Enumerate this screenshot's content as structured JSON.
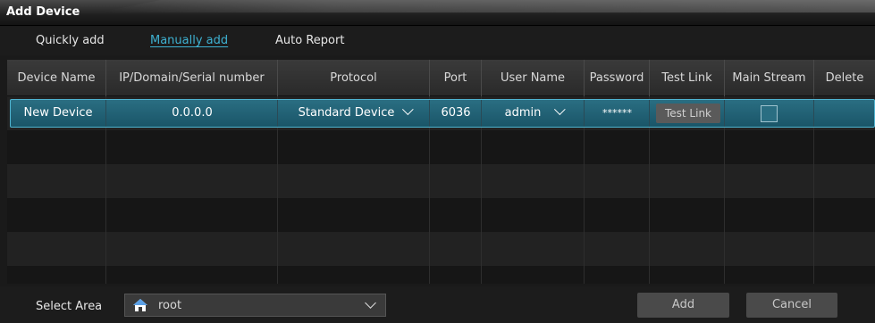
{
  "window": {
    "title": "Add Device"
  },
  "tabs": [
    {
      "label": "Quickly add"
    },
    {
      "label": "Manually add"
    },
    {
      "label": "Auto Report"
    }
  ],
  "columns": [
    "Device Name",
    "IP/Domain/Serial number",
    "Protocol",
    "Port",
    "User Name",
    "Password",
    "Test Link",
    "Main Stream",
    "Delete"
  ],
  "rows": [
    {
      "device_name": "New Device",
      "ip": "0.0.0.0",
      "protocol": "Standard Device",
      "port": "6036",
      "user_name": "admin",
      "password": "******",
      "test_link_label": "Test Link",
      "main_stream_checked": false
    }
  ],
  "footer": {
    "select_area_label": "Select Area",
    "area_value": "root",
    "add_label": "Add",
    "cancel_label": "Cancel"
  },
  "colors": {
    "accent": "#3eb1d1",
    "selected_row": "#1f5f73"
  }
}
